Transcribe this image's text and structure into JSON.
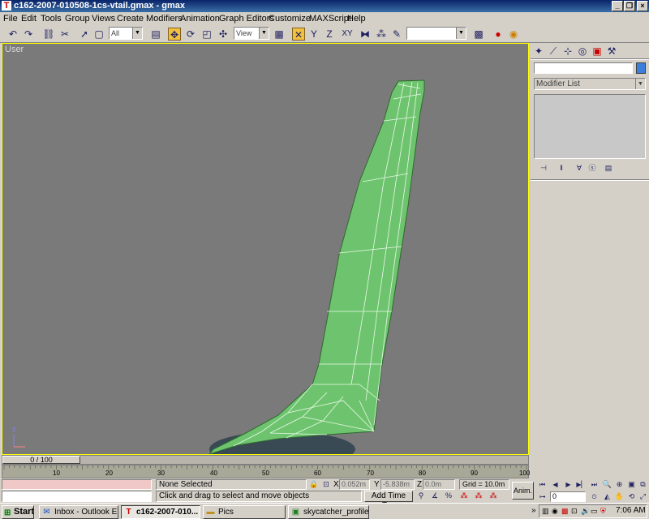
{
  "window": {
    "title": "c162-2007-010508-1cs-vtail.gmax - gmax"
  },
  "menu": [
    "File",
    "Edit",
    "Tools",
    "Group",
    "Views",
    "Create",
    "Modifiers",
    "Animation",
    "Graph Editors",
    "Customize",
    "MAXScript",
    "Help"
  ],
  "toolbar": {
    "selection_filter": "All",
    "coord_system": "View",
    "named_selection": ""
  },
  "viewport": {
    "label": "User",
    "model_color": "#6ec46e",
    "wire_color": "#e8f8e8"
  },
  "command_panel": {
    "name_field": "",
    "modifier_list": "Modifier List",
    "color_swatch": "#3a7fdc"
  },
  "timeline": {
    "frame_display": "0 / 100",
    "ticks": [
      "10",
      "20",
      "30",
      "40",
      "50",
      "60",
      "70",
      "80",
      "90",
      "100"
    ]
  },
  "status": {
    "selection": "None Selected",
    "prompt": "Click and drag to select and move objects",
    "x_label": "X",
    "x_value": "0.052m",
    "y_label": "Y",
    "y_value": "-5.838m",
    "z_label": "Z",
    "z_value": "0.0m",
    "grid": "Grid = 10.0m",
    "add_time_tag": "Add Time Tag",
    "anim": "Anim.",
    "frame_spinner": "0"
  },
  "taskbar": {
    "start": "Start",
    "tasks": [
      {
        "label": "Inbox - Outlook E...",
        "icon": "outlook-icon"
      },
      {
        "label": "c162-2007-010...",
        "icon": "gmax-icon"
      },
      {
        "label": "Pics",
        "icon": "folder-icon"
      },
      {
        "label": "skycatcher_profile....",
        "icon": "image-icon"
      }
    ],
    "clock": "7:06 AM"
  }
}
